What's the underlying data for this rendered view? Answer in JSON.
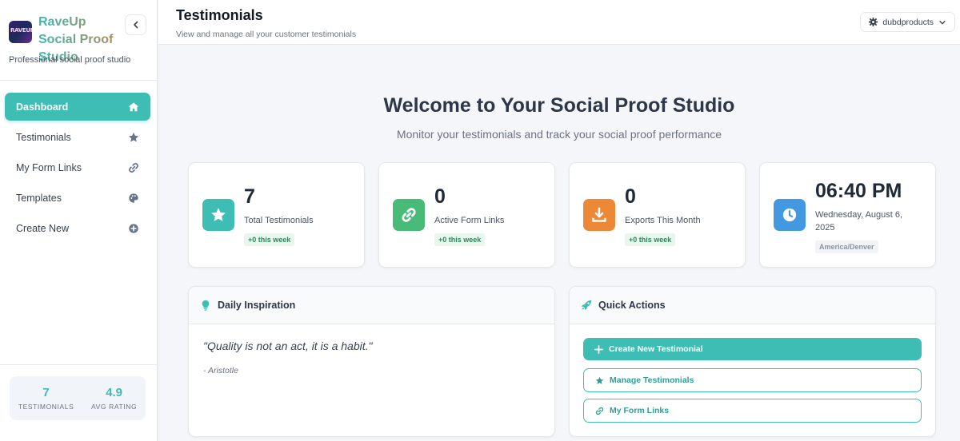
{
  "sidebar": {
    "logo_text": "RAVEUP",
    "brand_name": "RaveUp Social Proof Studio",
    "tagline": "Professional social proof studio",
    "nav": [
      {
        "label": "Dashboard",
        "icon": "home-icon"
      },
      {
        "label": "Testimonials",
        "icon": "star-icon"
      },
      {
        "label": "My Form Links",
        "icon": "link-icon"
      },
      {
        "label": "Templates",
        "icon": "palette-icon"
      },
      {
        "label": "Create New",
        "icon": "plus-circle-icon"
      }
    ],
    "stats": [
      {
        "value": "7",
        "label": "TESTIMONIALS"
      },
      {
        "value": "4.9",
        "label": "AVG RATING"
      }
    ]
  },
  "header": {
    "title": "Testimonials",
    "subtitle": "View and manage all your customer testimonials",
    "user": "dubdproducts"
  },
  "main": {
    "welcome_title": "Welcome to Your Social Proof Studio",
    "welcome_subtitle": "Monitor your testimonials and track your social proof performance",
    "stat_cards": [
      {
        "value": "7",
        "label": "Total Testimonials",
        "badge": "+0 this week",
        "icon": "star-icon",
        "color": "#3dbdb3"
      },
      {
        "value": "0",
        "label": "Active Form Links",
        "badge": "+0 this week",
        "icon": "link-icon",
        "color": "#48bb78"
      },
      {
        "value": "0",
        "label": "Exports This Month",
        "badge": "+0 this week",
        "icon": "download-icon",
        "color": "#ed8936"
      }
    ],
    "clock": {
      "time": "06:40 PM",
      "date": "Wednesday, August 6, 2025",
      "timezone": "America/Denver",
      "color": "#4299e1"
    },
    "inspiration": {
      "title": "Daily Inspiration",
      "quote": "\"Quality is not an act, it is a habit.\"",
      "author": "- Aristotle"
    },
    "quick_actions": {
      "title": "Quick Actions",
      "buttons": [
        {
          "label": "Create New Testimonial",
          "icon": "plus-icon"
        },
        {
          "label": "Manage Testimonials",
          "icon": "star-icon"
        },
        {
          "label": "My Form Links",
          "icon": "link-icon"
        }
      ]
    }
  },
  "colors": {
    "accent": "#3dbdb3",
    "success_badge": "#2f855a"
  }
}
